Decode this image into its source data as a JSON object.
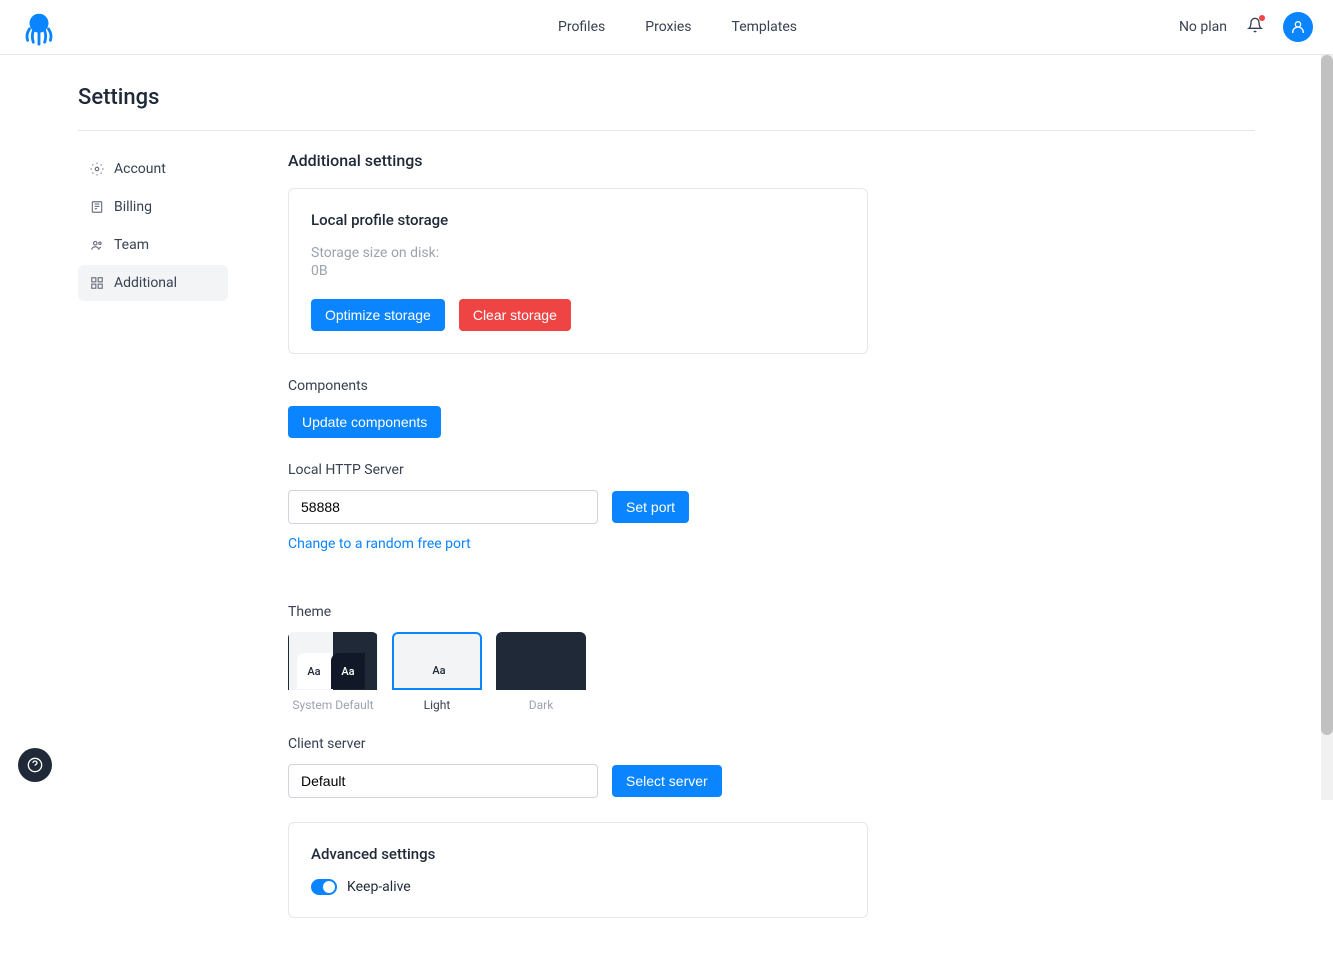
{
  "header": {
    "nav": {
      "profiles": "Profiles",
      "proxies": "Proxies",
      "templates": "Templates"
    },
    "plan": "No plan"
  },
  "page": {
    "title": "Settings"
  },
  "sidebar": {
    "account": "Account",
    "billing": "Billing",
    "team": "Team",
    "additional": "Additional"
  },
  "main": {
    "title": "Additional settings",
    "storage": {
      "title": "Local profile storage",
      "label": "Storage size on disk:",
      "value": "0B",
      "optimize": "Optimize storage",
      "clear": "Clear storage"
    },
    "components": {
      "label": "Components",
      "button": "Update components"
    },
    "http": {
      "label": "Local HTTP Server",
      "value": "58888",
      "button": "Set port",
      "link": "Change to a random free port"
    },
    "theme": {
      "label": "Theme",
      "aa": "Aa",
      "system": "System Default",
      "light": "Light",
      "dark": "Dark"
    },
    "server": {
      "label": "Client server",
      "value": "Default",
      "button": "Select server"
    },
    "advanced": {
      "title": "Advanced settings",
      "keepalive": "Keep-alive"
    }
  }
}
